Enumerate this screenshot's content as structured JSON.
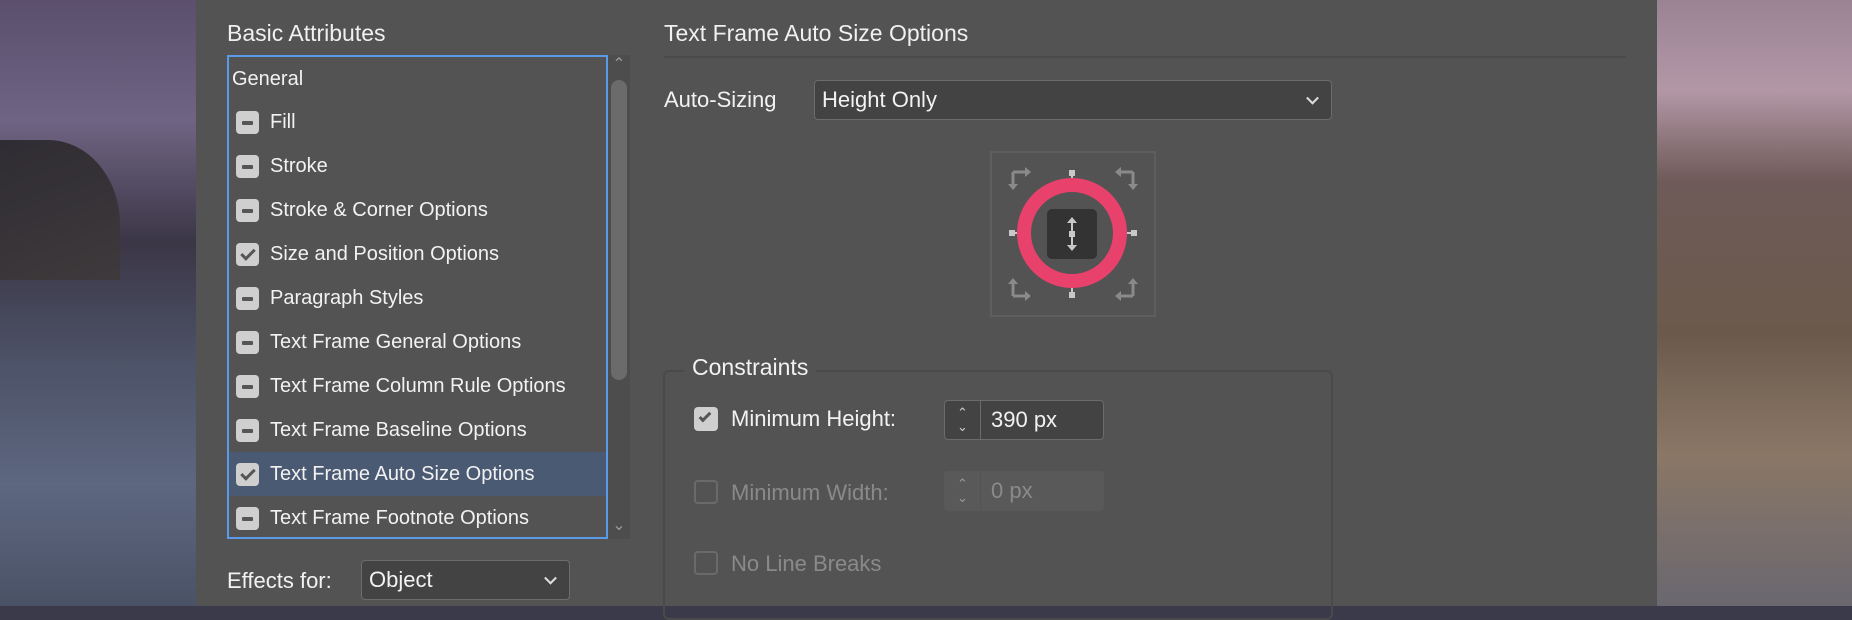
{
  "left_panel": {
    "title": "Basic Attributes",
    "items": [
      {
        "label": "General",
        "state": "none"
      },
      {
        "label": "Fill",
        "state": "mixed"
      },
      {
        "label": "Stroke",
        "state": "mixed"
      },
      {
        "label": "Stroke & Corner Options",
        "state": "mixed"
      },
      {
        "label": "Size and Position Options",
        "state": "checked"
      },
      {
        "label": "Paragraph Styles",
        "state": "mixed"
      },
      {
        "label": "Text Frame General Options",
        "state": "mixed"
      },
      {
        "label": "Text Frame Column Rule Options",
        "state": "mixed"
      },
      {
        "label": "Text Frame Baseline Options",
        "state": "mixed"
      },
      {
        "label": "Text Frame Auto Size Options",
        "state": "checked",
        "selected": true
      },
      {
        "label": "Text Frame Footnote Options",
        "state": "mixed"
      }
    ],
    "effects_for_label": "Effects for:",
    "effects_for_value": "Object"
  },
  "right_panel": {
    "title": "Text Frame Auto Size Options",
    "auto_sizing_label": "Auto-Sizing",
    "auto_sizing_value": "Height Only",
    "reference_point": "center",
    "highlight_color": "#e8416c",
    "constraints": {
      "title": "Constraints",
      "min_height": {
        "label": "Minimum Height:",
        "checked": true,
        "value": "390 px"
      },
      "min_width": {
        "label": "Minimum Width:",
        "checked": false,
        "value": "0 px",
        "disabled": true
      },
      "no_line_breaks": {
        "label": "No Line Breaks",
        "checked": false,
        "disabled": true
      }
    }
  }
}
